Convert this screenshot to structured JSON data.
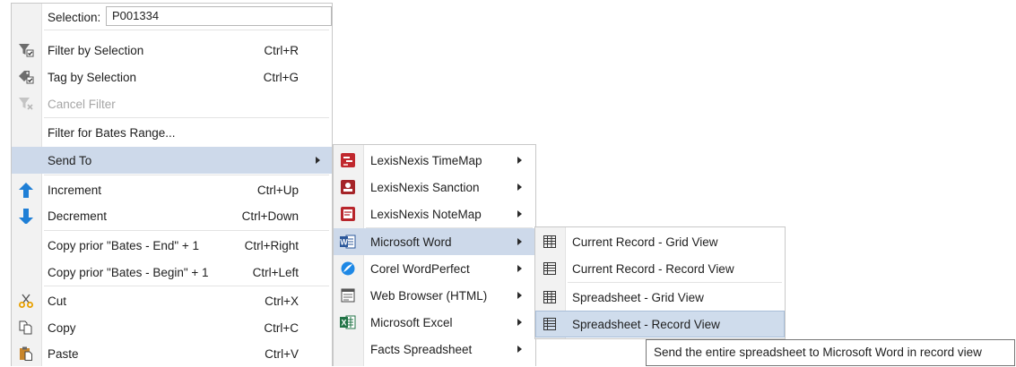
{
  "main_menu": {
    "selection_label": "Selection:",
    "selection_value": "P001334",
    "items": [
      {
        "label": "Filter by Selection",
        "shortcut": "Ctrl+R"
      },
      {
        "label": "Tag by Selection",
        "shortcut": "Ctrl+G"
      },
      {
        "label": "Cancel Filter",
        "shortcut": ""
      },
      {
        "label": "Filter for Bates Range...",
        "shortcut": ""
      },
      {
        "label": "Send To",
        "shortcut": ""
      },
      {
        "label": "Increment",
        "shortcut": "Ctrl+Up"
      },
      {
        "label": "Decrement",
        "shortcut": "Ctrl+Down"
      },
      {
        "label": "Copy prior \"Bates - End\" + 1",
        "shortcut": "Ctrl+Right"
      },
      {
        "label": "Copy prior \"Bates - Begin\" + 1",
        "shortcut": "Ctrl+Left"
      },
      {
        "label": "Cut",
        "shortcut": "Ctrl+X"
      },
      {
        "label": "Copy",
        "shortcut": "Ctrl+C"
      },
      {
        "label": "Paste",
        "shortcut": "Ctrl+V"
      }
    ]
  },
  "send_to_menu": {
    "items": [
      {
        "label": "LexisNexis TimeMap"
      },
      {
        "label": "LexisNexis Sanction"
      },
      {
        "label": "LexisNexis NoteMap"
      },
      {
        "label": "Microsoft Word"
      },
      {
        "label": "Corel WordPerfect"
      },
      {
        "label": "Web Browser (HTML)"
      },
      {
        "label": "Microsoft Excel"
      },
      {
        "label": "Facts Spreadsheet"
      }
    ]
  },
  "word_menu": {
    "items": [
      {
        "label": "Current Record - Grid View"
      },
      {
        "label": "Current Record - Record View"
      },
      {
        "label": "Spreadsheet - Grid View"
      },
      {
        "label": "Spreadsheet - Record View"
      }
    ]
  },
  "tooltip": {
    "text": "Send the entire spreadsheet to Microsoft Word in record view"
  },
  "colors": {
    "highlight": "#cdd9ea",
    "menu_border": "#c8c8c8",
    "gutter": "#f2f2f2",
    "disabled_text": "#a6a6a6",
    "arrow_blue": "#1f7fd6",
    "lexis_red": "#c0282e",
    "word_blue": "#2b579a",
    "excel_green": "#217346"
  }
}
